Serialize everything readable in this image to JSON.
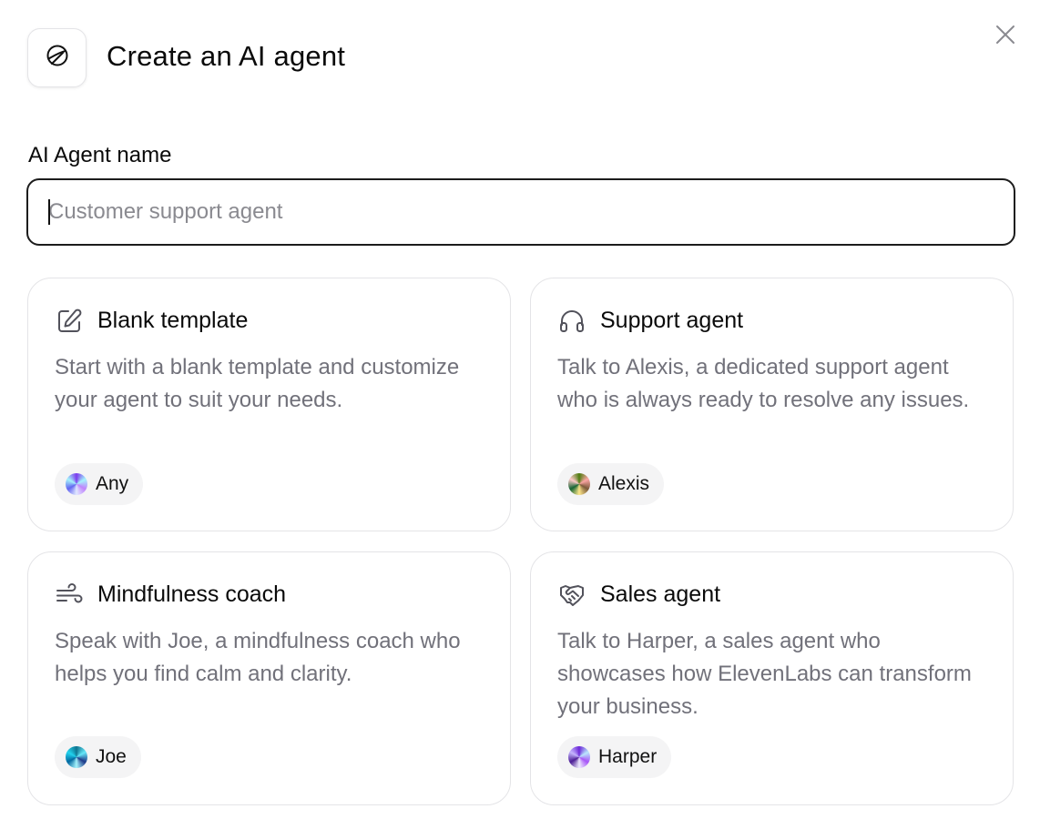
{
  "dialog": {
    "title": "Create an AI agent",
    "logo_icon": "agent-logo-icon",
    "close_icon": "close-icon"
  },
  "name_field": {
    "label": "AI Agent name",
    "placeholder": "Customer support agent",
    "value": ""
  },
  "templates": [
    {
      "title": "Blank template",
      "icon": "edit-icon",
      "description": "Start with a blank template and customize your agent to suit your needs.",
      "voice": "Any",
      "voice_colors": [
        "#7c3aed",
        "#a5f3fc",
        "#c084fc",
        "#e0e7ff"
      ]
    },
    {
      "title": "Support agent",
      "icon": "headset-icon",
      "description": "Talk to Alexis, a dedicated support agent who is always ready to resolve any issues.",
      "voice": "Alexis",
      "voice_colors": [
        "#4d7c0f",
        "#fca5a5",
        "#7c5a3a",
        "#fde68a"
      ]
    },
    {
      "title": "Mindfulness coach",
      "icon": "wind-icon",
      "description": "Speak with Joe, a mindfulness coach who helps you find calm and clarity.",
      "voice": "Joe",
      "voice_colors": [
        "#0e7490",
        "#67e8f9",
        "#1e3a8a",
        "#a5f3fc"
      ]
    },
    {
      "title": "Sales agent",
      "icon": "handshake-icon",
      "description": "Talk to Harper, a sales agent who showcases how ElevenLabs can transform your business.",
      "voice": "Harper",
      "voice_colors": [
        "#6d28d9",
        "#bae6fd",
        "#a855f7",
        "#ede9fe"
      ]
    }
  ]
}
